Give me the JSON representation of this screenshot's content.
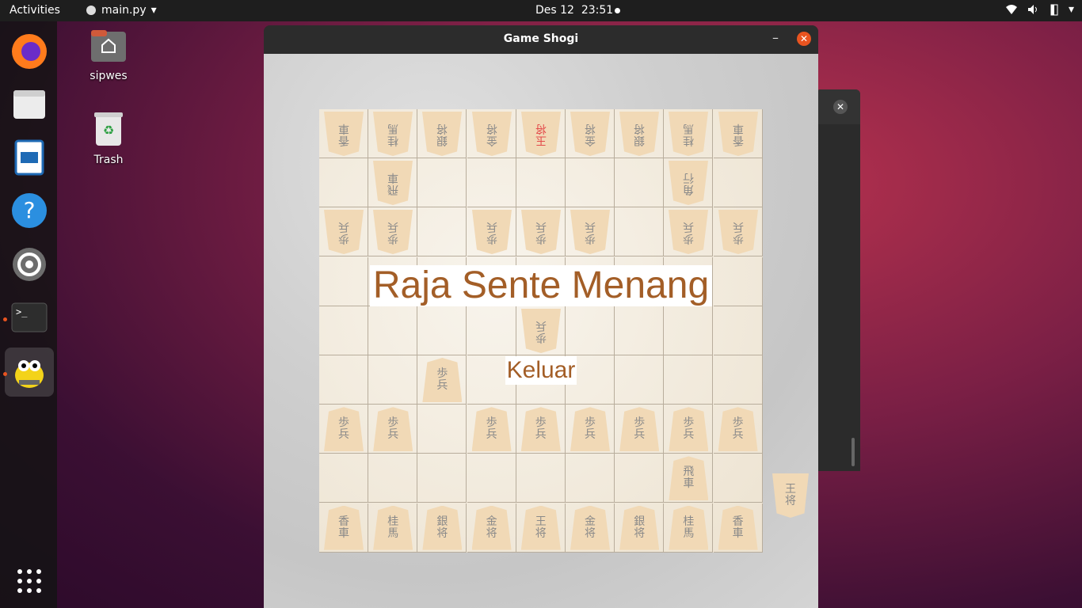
{
  "topbar": {
    "activities": "Activities",
    "app_name": "main.py",
    "date": "Des 12",
    "time": "23:51"
  },
  "dock": {
    "items": [
      "firefox-icon",
      "files-icon",
      "writer-icon",
      "help-icon",
      "settings-icon",
      "terminal-icon",
      "python-app-icon"
    ]
  },
  "desktop": {
    "icons": [
      {
        "label": "sipwes"
      },
      {
        "label": "Trash"
      }
    ]
  },
  "window": {
    "title": "Game Shogi",
    "overlay_title": "Raja Sente Menang",
    "exit_button": "Keluar"
  },
  "board": {
    "rows": [
      [
        [
          "香",
          "車",
          "g"
        ],
        [
          "桂",
          "馬",
          "g"
        ],
        [
          "銀",
          "将",
          "g"
        ],
        [
          "金",
          "将",
          "g"
        ],
        [
          "玉",
          "将",
          "gr"
        ],
        [
          "金",
          "将",
          "g"
        ],
        [
          "銀",
          "将",
          "g"
        ],
        [
          "桂",
          "馬",
          "g"
        ],
        [
          "香",
          "車",
          "g"
        ]
      ],
      [
        null,
        [
          "飛",
          "車",
          "g"
        ],
        null,
        null,
        null,
        null,
        null,
        [
          "角",
          "行",
          "g"
        ],
        null
      ],
      [
        [
          "歩",
          "兵",
          "g"
        ],
        [
          "歩",
          "兵",
          "g"
        ],
        null,
        [
          "歩",
          "兵",
          "g"
        ],
        [
          "歩",
          "兵",
          "g"
        ],
        [
          "歩",
          "兵",
          "g"
        ],
        null,
        [
          "歩",
          "兵",
          "g"
        ],
        [
          "歩",
          "兵",
          "g"
        ]
      ],
      [
        null,
        null,
        null,
        null,
        null,
        null,
        null,
        null,
        null
      ],
      [
        null,
        null,
        null,
        null,
        [
          "歩",
          "兵",
          "g"
        ],
        null,
        null,
        null,
        null
      ],
      [
        null,
        null,
        [
          "歩",
          "兵",
          "s"
        ],
        null,
        null,
        null,
        null,
        null,
        null
      ],
      [
        [
          "歩",
          "兵",
          "s"
        ],
        [
          "歩",
          "兵",
          "s"
        ],
        null,
        [
          "歩",
          "兵",
          "s"
        ],
        [
          "歩",
          "兵",
          "s"
        ],
        [
          "歩",
          "兵",
          "s"
        ],
        [
          "歩",
          "兵",
          "s"
        ],
        [
          "歩",
          "兵",
          "s"
        ],
        [
          "歩",
          "兵",
          "s"
        ]
      ],
      [
        null,
        null,
        null,
        null,
        null,
        null,
        null,
        [
          "飛",
          "車",
          "s"
        ],
        null
      ],
      [
        [
          "香",
          "車",
          "s"
        ],
        [
          "桂",
          "馬",
          "s"
        ],
        [
          "銀",
          "将",
          "s"
        ],
        [
          "金",
          "将",
          "s"
        ],
        [
          "王",
          "将",
          "s"
        ],
        [
          "金",
          "将",
          "s"
        ],
        [
          "銀",
          "将",
          "s"
        ],
        [
          "桂",
          "馬",
          "s"
        ],
        [
          "香",
          "車",
          "s"
        ]
      ]
    ],
    "captured": [
      "王",
      "将"
    ]
  }
}
